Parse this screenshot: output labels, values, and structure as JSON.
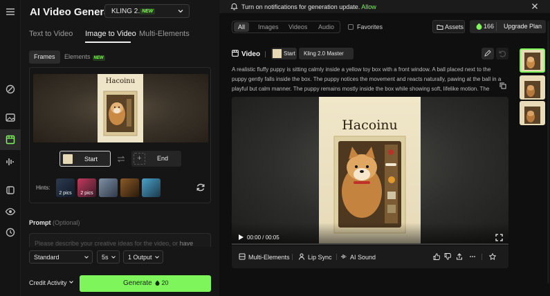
{
  "app": {
    "title": "AI Video Generator"
  },
  "model": {
    "name": "KLING 2.1",
    "badge": "NEW"
  },
  "mode_tabs": [
    "Text to Video",
    "Image to Video",
    "Multi-Elements"
  ],
  "active_mode": "Image to Video",
  "sub_tabs": {
    "frames": "Frames",
    "elements": "Elements",
    "elements_badge": "NEW"
  },
  "frames": {
    "start_label": "Start",
    "end_label": "End",
    "preview_brand": "Hacoinu"
  },
  "hints": {
    "label": "Hints:",
    "items": [
      {
        "caption": "2 pics"
      },
      {
        "caption": "2 pics"
      },
      {
        "caption": ""
      },
      {
        "caption": ""
      },
      {
        "caption": ""
      }
    ]
  },
  "prompt": {
    "label": "Prompt",
    "optional": "(Optional)",
    "placeholder": "Please describe your creative ideas for the video, or ",
    "placeholder_link": "have"
  },
  "settings": {
    "quality": "Standard",
    "duration": "5s",
    "outputs": "1 Output"
  },
  "footer": {
    "credit_activity": "Credit Activity",
    "generate": "Generate",
    "generate_cost": "20"
  },
  "notification": {
    "message": "Turn on notifications for generation update.",
    "allow": "Allow"
  },
  "filters": {
    "items": [
      "All",
      "Images",
      "Videos",
      "Audio"
    ],
    "active": "All",
    "favorites": "Favorites"
  },
  "topbar": {
    "assets": "Assets",
    "credits": "166",
    "upgrade": "Upgrade Plan"
  },
  "card": {
    "type_label": "Video",
    "start_chip": "Start",
    "model_chip": "Kling 2.0 Master",
    "description": "A realistic fluffy puppy is sitting calmly inside a yellow toy box with a front window. A ball placed next to the puppy gently falls inside the box. The puppy notices the movement and reacts naturally, pawing at the ball in a playful but calm manner. The puppy remains mostly inside the box while showing soft, lifelike motion. The animation is smo",
    "video_brand": "Hacoinu",
    "time": "00:00 / 00:05",
    "progress": 0.0,
    "actions": {
      "multi_elements": "Multi-Elements",
      "lip_sync": "Lip Sync",
      "ai_sound": "AI Sound"
    }
  },
  "colors": {
    "accent": "#7ef55a",
    "background": "#0d0d0d",
    "panel": "#161616"
  }
}
